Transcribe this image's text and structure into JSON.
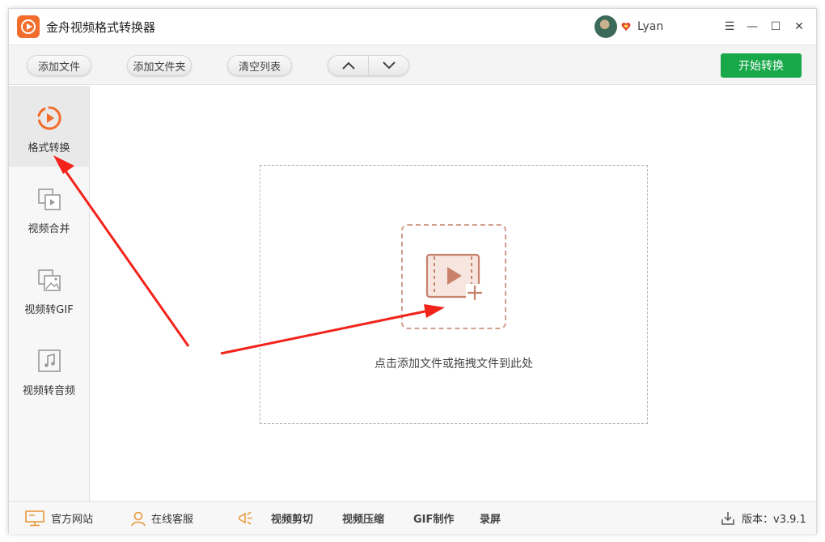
{
  "app": {
    "title": "金舟视频格式转换器",
    "brand_color": "#f26c2b"
  },
  "user": {
    "name": "Lyan"
  },
  "window_controls": {
    "menu": "☰",
    "minimize": "—",
    "maximize": "☐",
    "close": "✕"
  },
  "toolbar": {
    "add_file_label": "添加文件",
    "add_folder_label": "添加文件夹",
    "clear_list_label": "清空列表",
    "move_up_icon": "chevron-up-icon",
    "move_down_icon": "chevron-down-icon",
    "start_label": "开始转换",
    "start_color": "#17a84a"
  },
  "sidebar": {
    "items": [
      {
        "label": "格式转换",
        "icon": "format-convert-icon",
        "active": true
      },
      {
        "label": "视频合并",
        "icon": "video-merge-icon",
        "active": false
      },
      {
        "label": "视频转GIF",
        "icon": "video-to-gif-icon",
        "active": false
      },
      {
        "label": "视频转音频",
        "icon": "video-to-audio-icon",
        "active": false
      }
    ]
  },
  "main": {
    "drop_text": "点击添加文件或拖拽文件到此处",
    "drop_icon": "add-video-icon"
  },
  "statusbar": {
    "website_label": "官方网站",
    "support_label": "在线客服",
    "tools": [
      "视频剪切",
      "视频压缩",
      "GIF制作",
      "录屏"
    ],
    "version_label": "版本：v3.9.1"
  },
  "annotation_color": "#f2231b"
}
